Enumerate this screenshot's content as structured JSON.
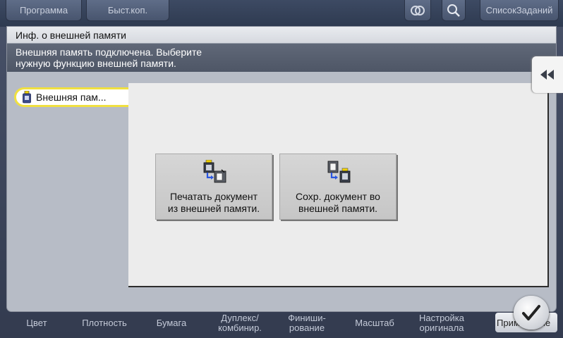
{
  "topbar": {
    "program_label": "Программа",
    "quick_copy_label": "Быст.коп.",
    "job_list_label": "СписокЗаданий"
  },
  "bottom_tabs": [
    {
      "line1": "Цвет",
      "line2": ""
    },
    {
      "line1": "Плотность",
      "line2": ""
    },
    {
      "line1": "Бумага",
      "line2": ""
    },
    {
      "line1": "Дуплекс/",
      "line2": "комбинир."
    },
    {
      "line1": "Финиши-",
      "line2": "рование"
    },
    {
      "line1": "Масштаб",
      "line2": ""
    },
    {
      "line1": "Настройка",
      "line2": "оригинала"
    }
  ],
  "apply_label": "Применение",
  "dialog": {
    "title": "Инф. о внешней памяти",
    "message_line1": "Внешняя память подключена. Выберите",
    "message_line2": "нужную функцию внешней памяти.",
    "nav_item_label": "Внешняя пам..."
  },
  "actions": {
    "print_line1": "Печатать документ",
    "print_line2": "из внешней памяти.",
    "save_line1": "Сохр. документ во",
    "save_line2": "внешней памяти."
  },
  "icons": {
    "link": "link-icon",
    "search": "search-icon",
    "usb": "usb-memory-icon",
    "collapse": "double-chevron-left-icon",
    "print_from_memory": "print-from-memory-icon",
    "save_to_memory": "save-to-memory-icon",
    "ok": "checkmark-icon"
  },
  "colors": {
    "nav_highlight": "#f0e040",
    "message_bar": "#585f6f"
  }
}
